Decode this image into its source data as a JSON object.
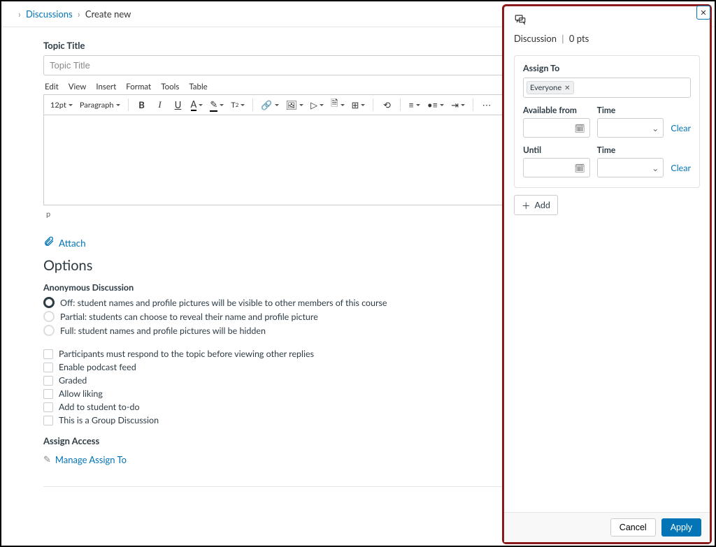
{
  "breadcrumb": {
    "items": [
      "Discussions",
      "Create new"
    ]
  },
  "main": {
    "title_label": "Topic Title",
    "title_placeholder": "Topic Title",
    "rce_menu": [
      "Edit",
      "View",
      "Insert",
      "Format",
      "Tools",
      "Table"
    ],
    "rce_fontsize": "12pt",
    "rce_paragraph": "Paragraph",
    "rce_status": "p",
    "attach_label": "Attach",
    "options_heading": "Options",
    "anon_heading": "Anonymous Discussion",
    "anon_options": [
      "Off: student names and profile pictures will be visible to other members of this course",
      "Partial: students can choose to reveal their name and profile picture",
      "Full: student names and profile pictures will be hidden"
    ],
    "checkboxes": [
      "Participants must respond to the topic before viewing other replies",
      "Enable podcast feed",
      "Graded",
      "Allow liking",
      "Add to student to-do",
      "This is a Group Discussion"
    ],
    "assign_access_label": "Assign Access",
    "manage_link": "Manage Assign To"
  },
  "panel": {
    "title": "Discussion",
    "points": "0 pts",
    "assign_to_label": "Assign To",
    "tag": "Everyone",
    "available_from_label": "Available from",
    "time_label": "Time",
    "until_label": "Until",
    "clear_label": "Clear",
    "add_label": "Add",
    "cancel": "Cancel",
    "apply": "Apply"
  }
}
